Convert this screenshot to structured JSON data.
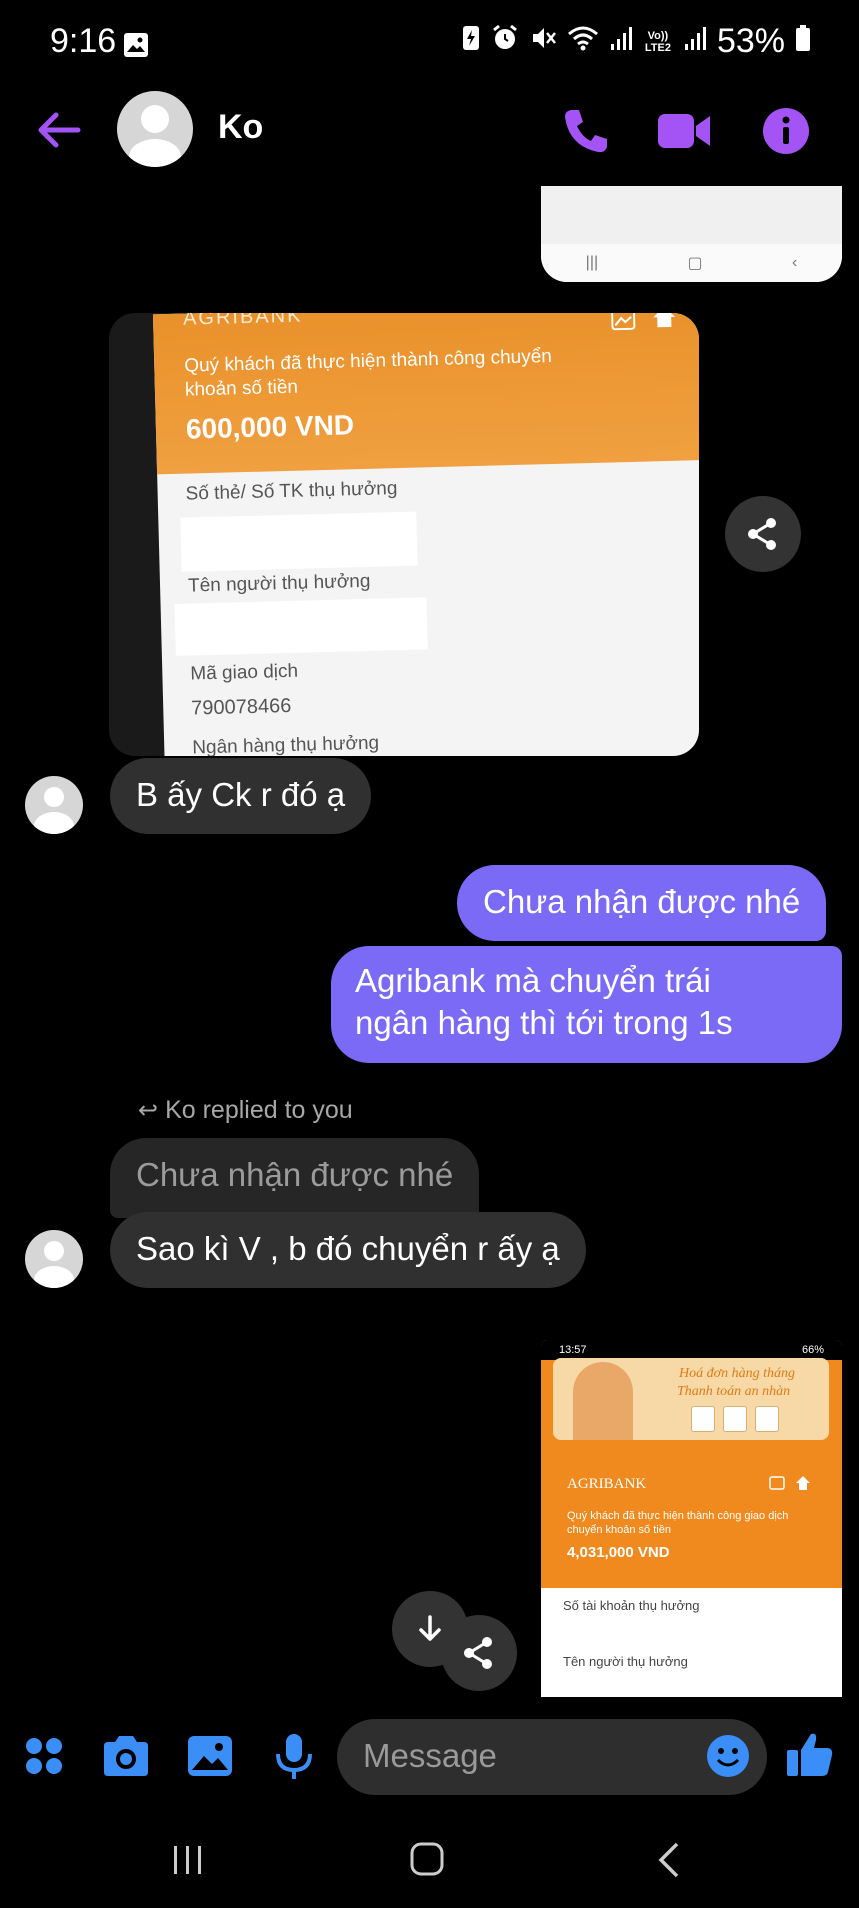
{
  "status_bar": {
    "time": "9:16",
    "battery": "53%",
    "icons": [
      "gallery-icon",
      "battery-saver-icon",
      "alarm-icon",
      "mute-icon",
      "wifi-icon",
      "signal-icon",
      "volte-icon",
      "signal-icon",
      "battery-icon"
    ],
    "volte_label": "Vo)) LTE2"
  },
  "header": {
    "contact_name": "Ko",
    "accent_color": "#a453f5"
  },
  "messages": {
    "image1": {
      "bank_name": "AGRIBANK",
      "line1": "Quý khách đã thực hiện thành công chuyển",
      "line2": "khoản số tiền",
      "amount": "600,000 VND",
      "field1": "Số thẻ/ Số TK thụ hưởng",
      "field2": "Tên người thụ hưởng",
      "field3": "Mã giao dịch",
      "transaction_id": "790078466",
      "field4": "Ngân hàng thụ hưởng"
    },
    "received1": "B ấy Ck r đó ạ",
    "sent1": "Chưa nhận được nhé",
    "sent2_line1": "Agribank mà chuyển trái",
    "sent2_line2": "ngân hàng thì tới trong 1s",
    "reply_label": "Ko replied to you",
    "reply_quote": "Chưa nhận được nhé",
    "received2": "Sao kì V , b đó chuyển r ấy ạ",
    "image2": {
      "status_time": "13:57",
      "status_battery": "66%",
      "banner_line1": "Hoá đơn hàng tháng",
      "banner_line2": "Thanh toán an nhàn",
      "bank_name": "AGRIBANK",
      "line1": "Quý khách đã thực hiện thành công giao dịch",
      "line2": "chuyển khoản số tiền",
      "amount": "4,031,000 VND",
      "field1": "Số tài khoản thụ hưởng",
      "field2": "Tên người thụ hưởng"
    },
    "sent_bubble_color": "#7a6af6",
    "received_bubble_color": "#303030"
  },
  "composer": {
    "placeholder": "Message",
    "icon_color": "#3a8ef6"
  }
}
